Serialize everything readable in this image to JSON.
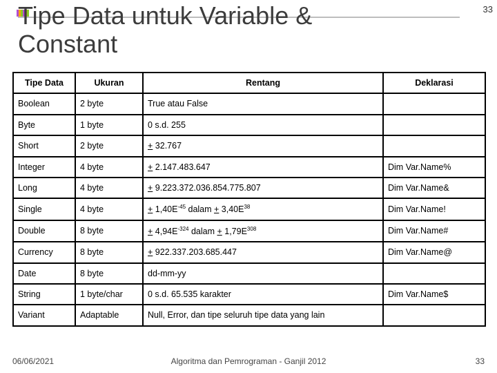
{
  "title_line1": "Tipe Data untuk Variable &",
  "title_line2": "Constant",
  "page_top": "33",
  "headers": {
    "c1": "Tipe Data",
    "c2": "Ukuran",
    "c3": "Rentang",
    "c4": "Deklarasi"
  },
  "rows": [
    {
      "t": "Boolean",
      "u": "2 byte",
      "r": "True atau False",
      "d": ""
    },
    {
      "t": "Byte",
      "u": "1 byte",
      "r": "0 s.d. 255",
      "d": ""
    },
    {
      "t": "Short",
      "u": "2 byte",
      "r": "+ 32.767",
      "d": "",
      "pm": true
    },
    {
      "t": "Integer",
      "u": "4 byte",
      "r": "+ 2.147.483.647",
      "d": "Dim Var.Name%",
      "pm": true
    },
    {
      "t": "Long",
      "u": "4 byte",
      "r": "+ 9.223.372.036.854.775.807",
      "d": "Dim Var.Name&",
      "pm": true
    },
    {
      "t": "Single",
      "u": "4 byte",
      "r_html": "<span class=\"u\">+</span> 1,40E<span class=\"sup\">-45</span> dalam <span class=\"u\">+</span> 3,40E<span class=\"sup\">38</span>",
      "d": "Dim Var.Name!"
    },
    {
      "t": "Double",
      "u": "8 byte",
      "r_html": "<span class=\"u\">+</span> 4,94E<span class=\"sup\">-324</span> dalam <span class=\"u\">+</span> 1,79E<span class=\"sup\">308</span>",
      "d": "Dim Var.Name#"
    },
    {
      "t": "Currency",
      "u": "8 byte",
      "r": "+ 922.337.203.685.447",
      "d": "Dim Var.Name@",
      "pm": true
    },
    {
      "t": "Date",
      "u": "8 byte",
      "r": "dd-mm-yy",
      "d": ""
    },
    {
      "t": "String",
      "u": "1 byte/char",
      "r": "0 s.d. 65.535 karakter",
      "d": "Dim Var.Name$"
    },
    {
      "t": "Variant",
      "u": "Adaptable",
      "r": "Null, Error, dan tipe seluruh tipe data yang lain",
      "d": ""
    }
  ],
  "footer": {
    "left": "06/06/2021",
    "center": "Algoritma dan Pemrograman - Ganjil 2012",
    "right": "33"
  }
}
